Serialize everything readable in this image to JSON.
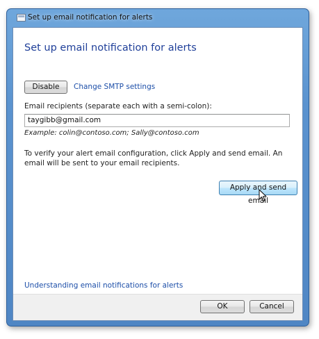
{
  "window": {
    "title": "Set up email notification for alerts"
  },
  "main": {
    "heading": "Set up email notification for alerts",
    "disable_button": "Disable",
    "smtp_link": "Change SMTP settings",
    "recipients_label": "Email recipients (separate each with a semi-colon):",
    "recipients_value": "taygibb@gmail.com",
    "example_text": "Example: colin@contoso.com; Sally@contoso.com",
    "instructions": "To verify your alert email configuration, click Apply and send email. An email will be sent to your email recipients.",
    "apply_button": "Apply and send email",
    "understanding_link": "Understanding email notifications for alerts"
  },
  "footer": {
    "ok_button": "OK",
    "cancel_button": "Cancel"
  },
  "icons": {
    "window_icon": "window-icon",
    "cursor": "mouse-pointer-icon"
  },
  "colors": {
    "heading": "#1f3f99",
    "link": "#1c4ea8",
    "frame": "#5b93cf"
  }
}
